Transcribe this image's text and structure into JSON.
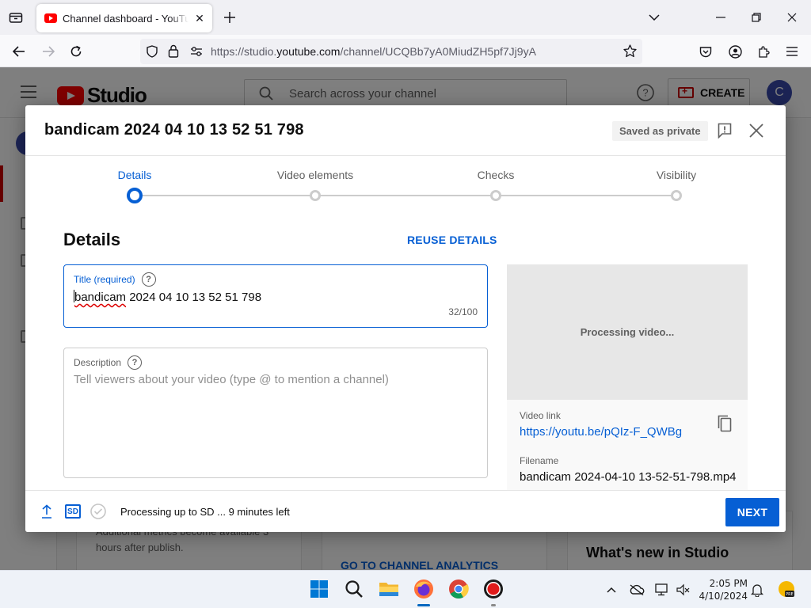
{
  "browser": {
    "tab_title": "Channel dashboard - YouTube Studio",
    "url_prefix": "https://studio.",
    "url_domain": "youtube.com",
    "url_path": "/channel/UCQBb7yA0MiudZH5pf7Jj9yA"
  },
  "studio": {
    "logo_text": "Studio",
    "search_placeholder": "Search across your channel",
    "create_label": "CREATE",
    "avatar_letter": "C",
    "bg_text_1": "Additional metrics become available 3",
    "bg_text_2": "hours after publish.",
    "bg_link": "GO TO CHANNEL ANALYTICS",
    "bg_heading": "What's new in Studio"
  },
  "dialog": {
    "title": "bandicam 2024 04 10 13 52 51 798",
    "saved_badge": "Saved as private",
    "steps": [
      {
        "label": "Details",
        "active": true
      },
      {
        "label": "Video elements",
        "active": false
      },
      {
        "label": "Checks",
        "active": false
      },
      {
        "label": "Visibility",
        "active": false
      }
    ],
    "section_title": "Details",
    "reuse_label": "REUSE DETAILS",
    "title_field": {
      "label": "Title (required)",
      "value_first": "bandicam",
      "value_rest": " 2024 04 10 13 52 51 798",
      "counter": "32/100"
    },
    "description_field": {
      "label": "Description",
      "placeholder": "Tell viewers about your video (type @ to mention a channel)"
    },
    "preview": {
      "status": "Processing video...",
      "video_link_label": "Video link",
      "video_link": "https://youtu.be/pQIz-F_QWBg",
      "filename_label": "Filename",
      "filename": "bandicam 2024-04-10 13-52-51-798.mp4"
    },
    "footer": {
      "sd_label": "SD",
      "status": "Processing up to SD ... 9 minutes left",
      "next_label": "NEXT"
    }
  },
  "taskbar": {
    "time": "2:05 PM",
    "date": "4/10/2024",
    "accent": "#0067c0"
  }
}
